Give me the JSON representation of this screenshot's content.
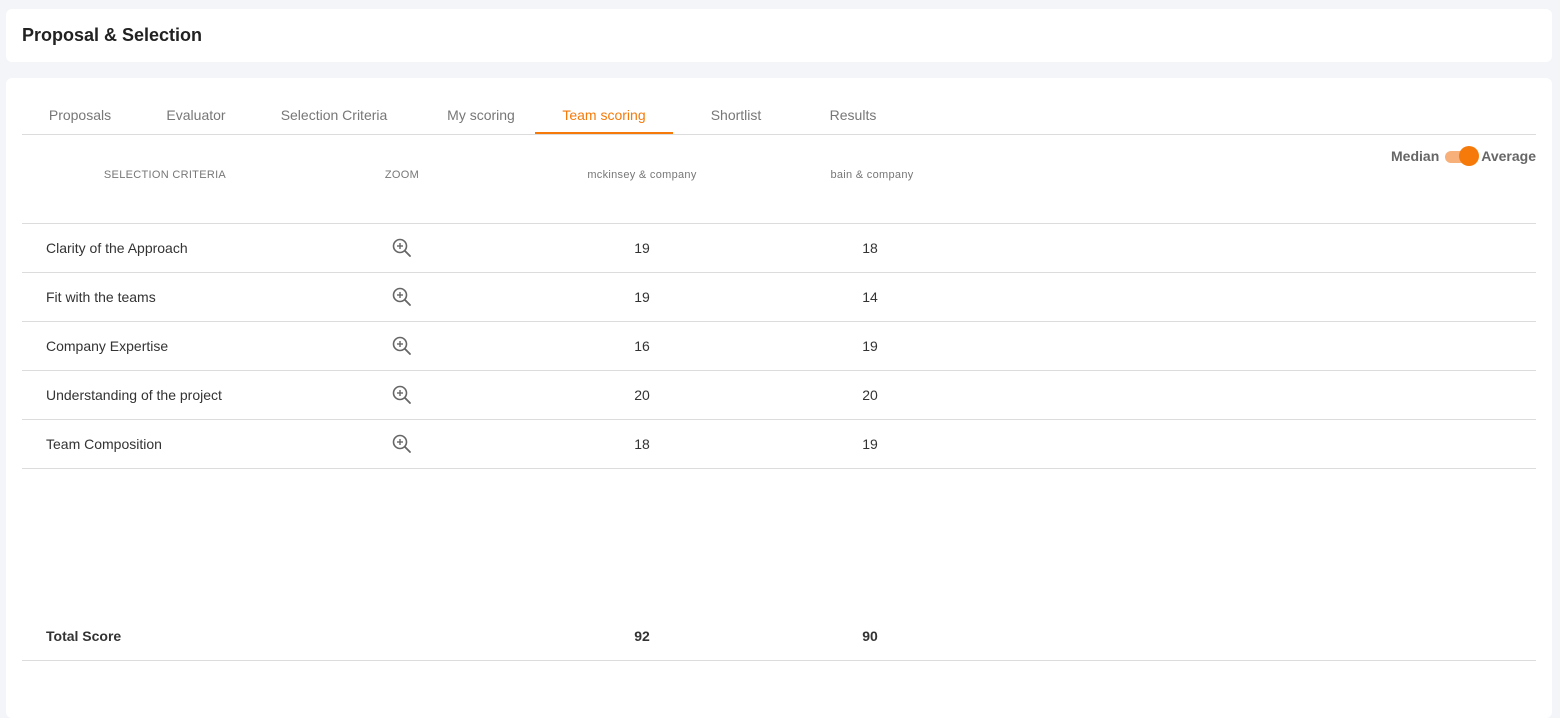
{
  "header": {
    "title": "Proposal & Selection"
  },
  "tabs": [
    {
      "label": "Proposals"
    },
    {
      "label": "Evaluator"
    },
    {
      "label": "Selection Criteria"
    },
    {
      "label": "My scoring"
    },
    {
      "label": "Team scoring",
      "active": true
    },
    {
      "label": "Shortlist"
    },
    {
      "label": "Results"
    }
  ],
  "toggle": {
    "left_label": "Median",
    "right_label": "Average",
    "selected": "Average"
  },
  "table": {
    "headers": {
      "criteria": "SELECTION CRITERIA",
      "zoom": "ZOOM",
      "company1": "mckinsey & company",
      "company2": "bain & company"
    },
    "rows": [
      {
        "criteria": "Clarity of the Approach",
        "c1": "19",
        "c2": "18"
      },
      {
        "criteria": "Fit with the teams",
        "c1": "19",
        "c2": "14"
      },
      {
        "criteria": "Company Expertise",
        "c1": "16",
        "c2": "19"
      },
      {
        "criteria": "Understanding of the project",
        "c1": "20",
        "c2": "20"
      },
      {
        "criteria": "Team Composition",
        "c1": "18",
        "c2": "19"
      }
    ],
    "total": {
      "label": "Total Score",
      "c1": "92",
      "c2": "90"
    }
  },
  "colors": {
    "accent": "#f57a0a",
    "accent_light": "#f7b07a"
  },
  "icons": {
    "zoom": "zoom-in-icon"
  }
}
